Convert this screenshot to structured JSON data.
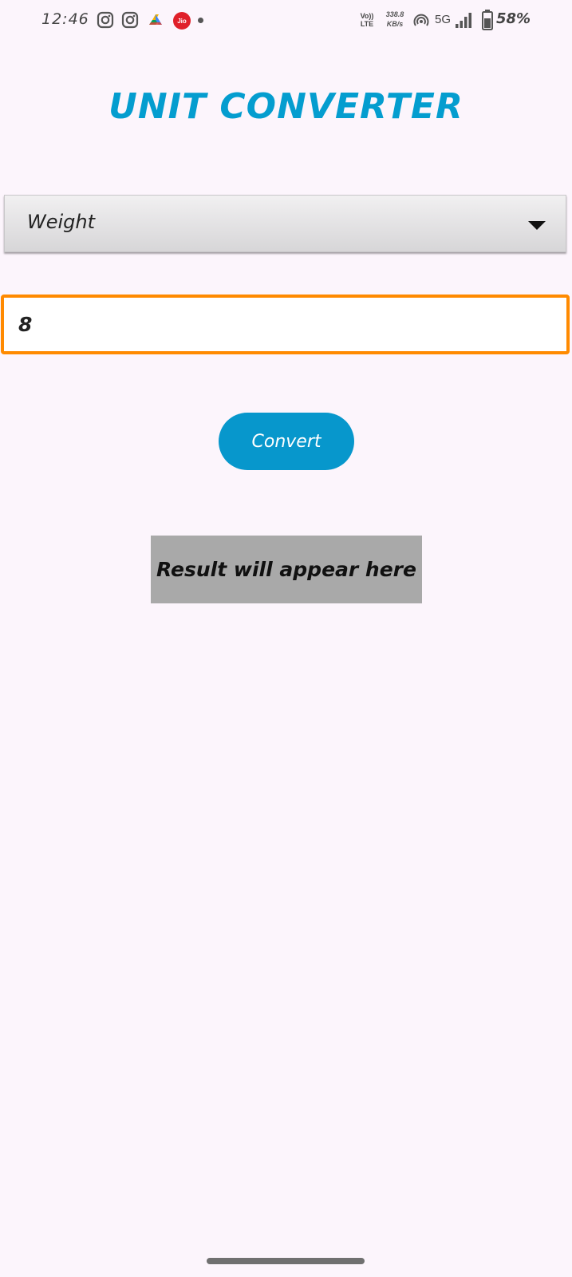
{
  "status_bar": {
    "time": "12:46",
    "notification_icons": [
      "instagram-icon",
      "instagram-icon",
      "drive-icon",
      "jio-icon",
      "dot-icon"
    ],
    "jio_label": "Jio",
    "volte_top": "Vo))",
    "volte_bottom": "LTE",
    "speed_value": "338.8",
    "speed_unit": "KB/s",
    "network": "5G",
    "battery_percent": "58%"
  },
  "app": {
    "title": "UNIT CONVERTER",
    "title_color": "#049DCF"
  },
  "unit_selector": {
    "selected": "Weight"
  },
  "value_input": {
    "value": "8",
    "border_color": "#FF8A00"
  },
  "convert_button": {
    "label": "Convert",
    "color": "#0797CC"
  },
  "result": {
    "text": "Result will appear here"
  }
}
